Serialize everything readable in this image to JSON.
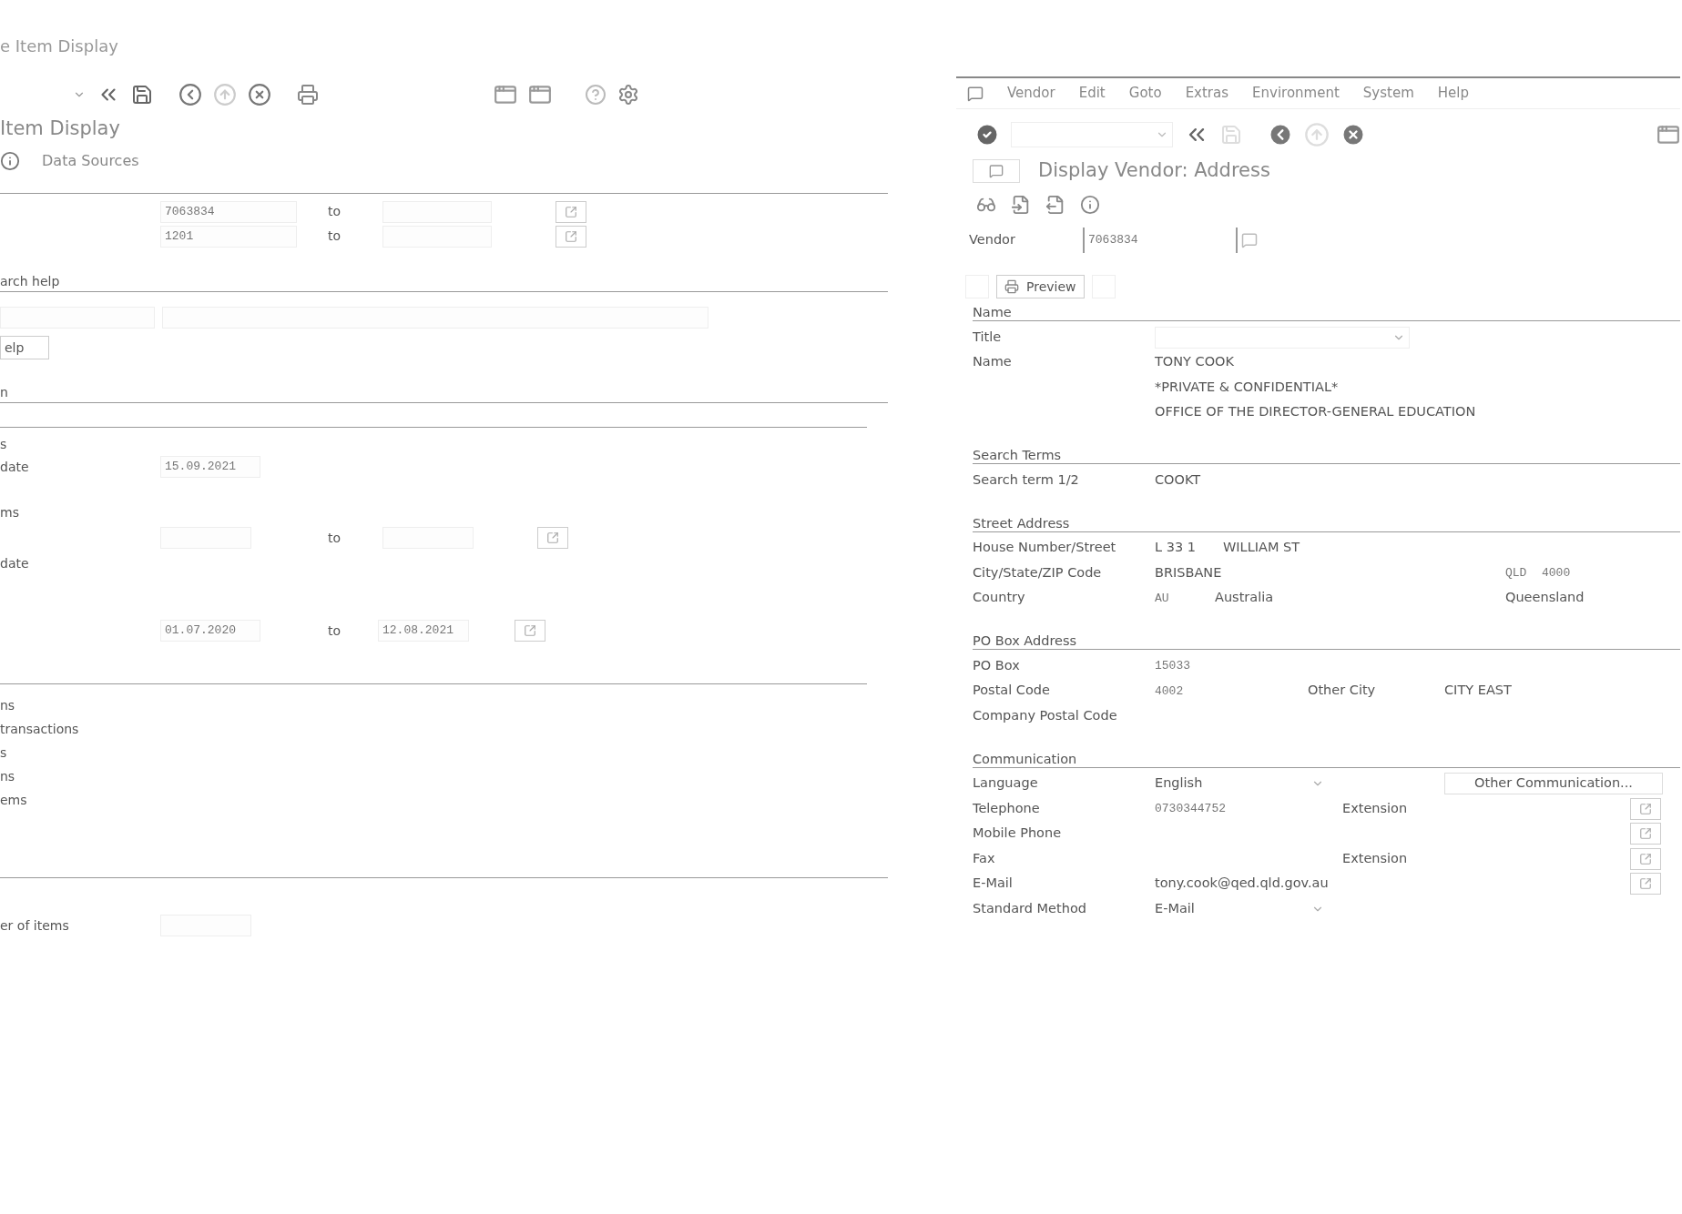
{
  "left_window": {
    "title": "e Item Display",
    "screen_title": "Item Display",
    "data_sources": "Data Sources",
    "selection": [
      {
        "value": "7063834",
        "to_label": "to"
      },
      {
        "value": "1201",
        "to_label": "to"
      }
    ],
    "search_help": {
      "heading": "arch help",
      "button": "elp"
    },
    "section_heading": "n",
    "status": {
      "label": "s",
      "open_date_label": "date",
      "open_date": "15.09.2021",
      "items_label": "ms",
      "range_to_label": "to",
      "date_label": "date",
      "range_from": "01.07.2020",
      "range2_to_label": "to",
      "range2_to": "12.08.2021"
    },
    "types": [
      "ns",
      "transactions",
      "s",
      "ns",
      "ems"
    ],
    "list_label": "er of items"
  },
  "right_window": {
    "menu": [
      "Vendor",
      "Edit",
      "Goto",
      "Extras",
      "Environment",
      "System",
      "Help"
    ],
    "screen_title": "Display Vendor: Address",
    "vendor": {
      "label": "Vendor",
      "value": "7063834"
    },
    "preview_button": "Preview",
    "name_section": {
      "heading": "Name",
      "title_label": "Title",
      "name_label": "Name",
      "name_lines": [
        "TONY COOK",
        "*PRIVATE & CONFIDENTIAL*",
        "OFFICE OF THE DIRECTOR-GENERAL EDUCATION"
      ]
    },
    "search_terms": {
      "heading": "Search Terms",
      "label": "Search term 1/2",
      "value": "COOKT"
    },
    "street_address": {
      "heading": "Street Address",
      "house_label": "House Number/Street",
      "house_number": "L 33 1",
      "street": "WILLIAM ST",
      "city_label": "City/State/ZIP Code",
      "city": "BRISBANE",
      "state": "QLD",
      "zip": "4000",
      "country_label": "Country",
      "country_code": "AU",
      "country": "Australia",
      "region": "Queensland"
    },
    "po_box_address": {
      "heading": "PO Box Address",
      "po_box_label": "PO Box",
      "po_box": "15033",
      "postal_code_label": "Postal Code",
      "postal_code": "4002",
      "other_city_label": "Other City",
      "other_city": "CITY EAST",
      "company_postal_code_label": "Company Postal Code"
    },
    "communication": {
      "heading": "Communication",
      "language_label": "Language",
      "language": "English",
      "other_button": "Other Communication...",
      "telephone_label": "Telephone",
      "telephone": "0730344752",
      "extension_label": "Extension",
      "mobile_label": "Mobile Phone",
      "fax_label": "Fax",
      "fax_extension_label": "Extension",
      "email_label": "E-Mail",
      "email": "tony.cook@qed.qld.gov.au",
      "standard_method_label": "Standard Method",
      "standard_method": "E-Mail"
    }
  }
}
